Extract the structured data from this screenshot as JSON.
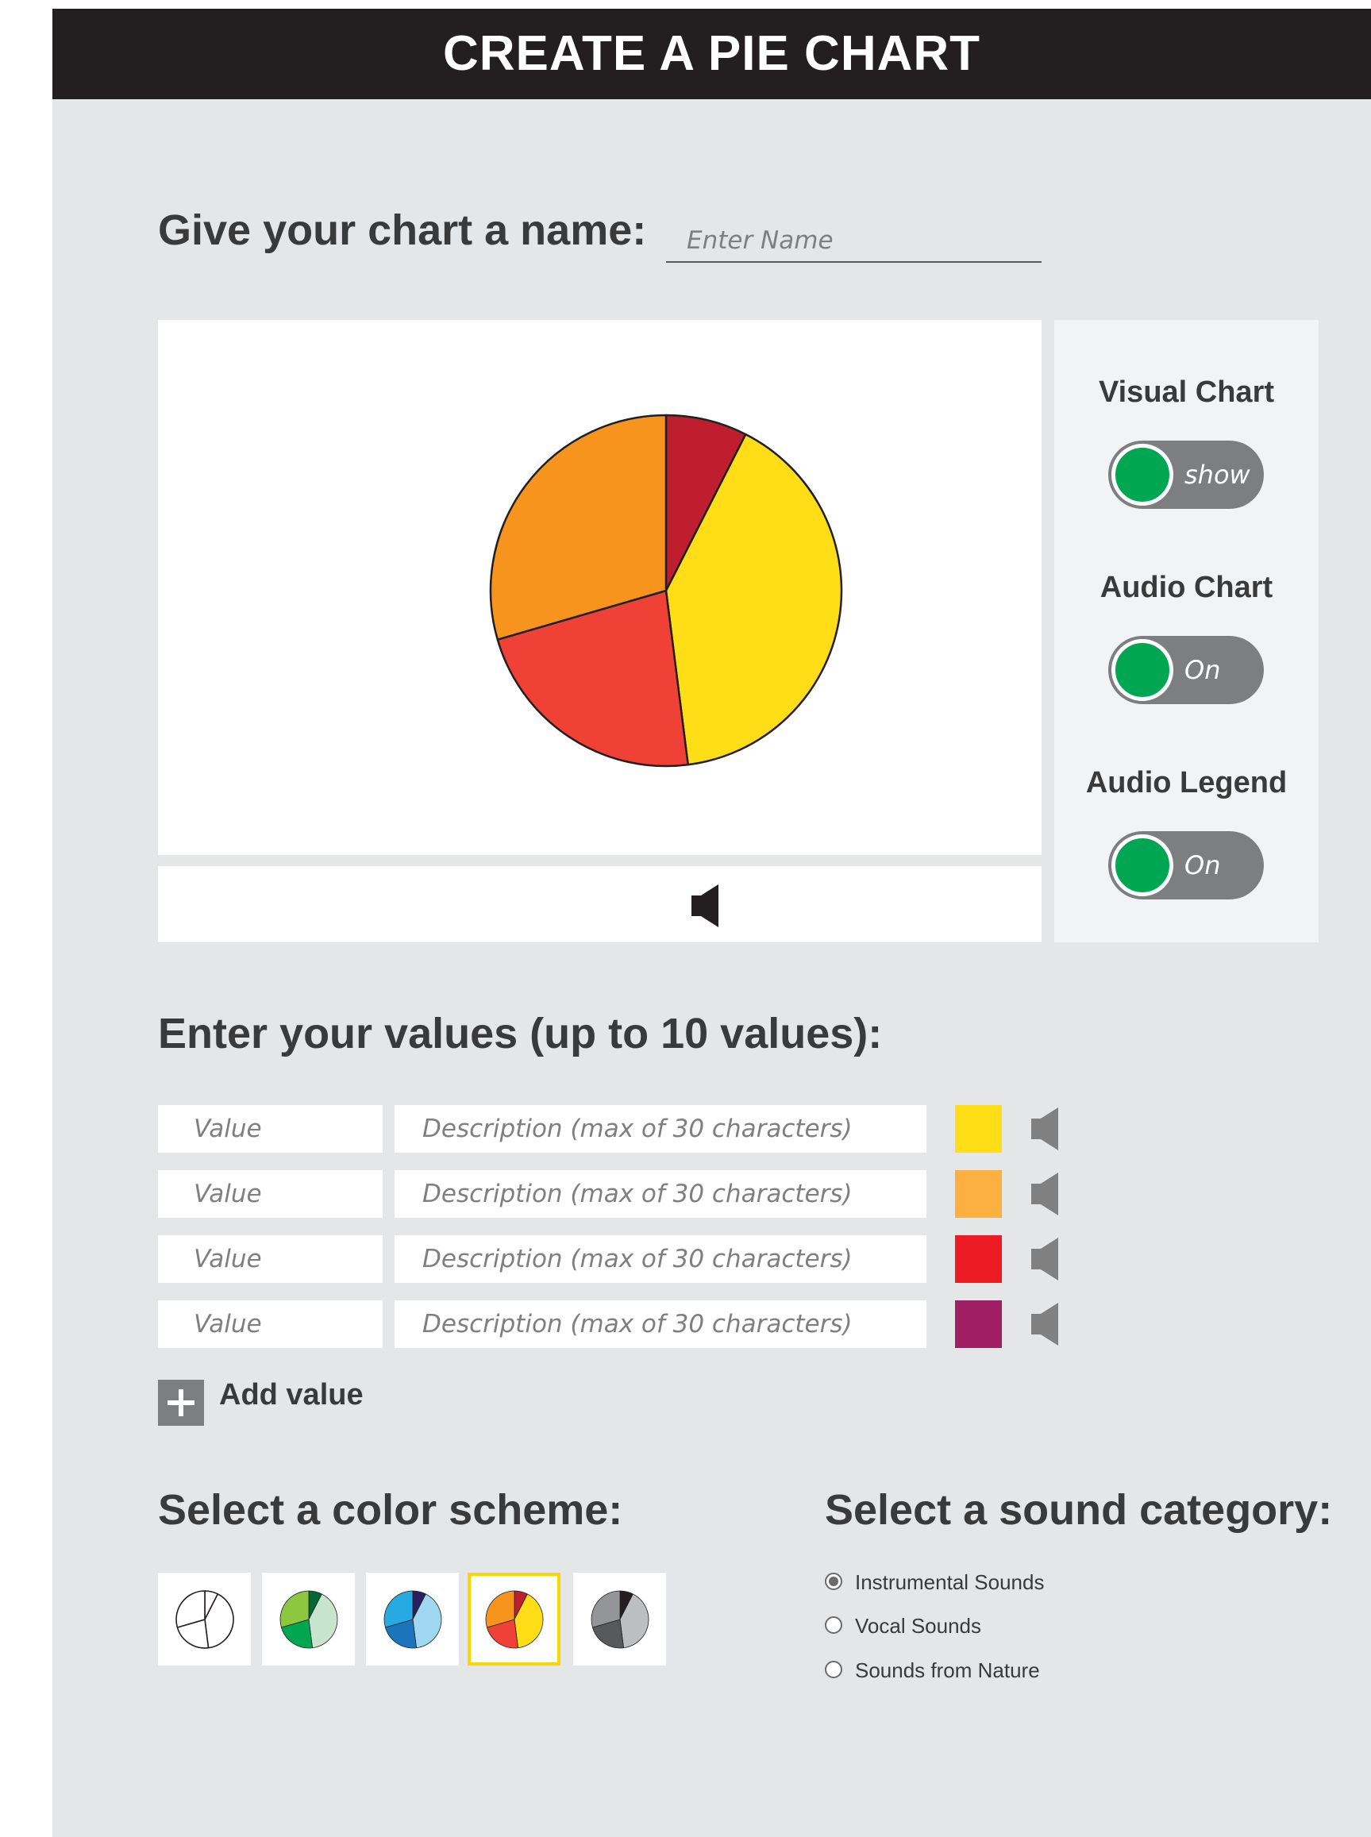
{
  "title": "CREATE A PIE CHART",
  "name_prompt": {
    "label": "Give your chart a name:",
    "placeholder": "Enter Name"
  },
  "chart_data": {
    "type": "pie",
    "values": [
      7.5,
      40.5,
      22.5,
      29.5
    ],
    "colors": [
      "#be1e2d",
      "#ffde17",
      "#ef4136",
      "#f7941d"
    ]
  },
  "toggles": [
    {
      "label": "Visual Chart",
      "state": "show"
    },
    {
      "label": "Audio Chart",
      "state": "On"
    },
    {
      "label": "Audio Legend",
      "state": "On"
    }
  ],
  "values_section": {
    "title": "Enter your values (up to 10 values):",
    "rows": [
      {
        "value_placeholder": "Value",
        "description_placeholder": "Description (max of 30 characters)",
        "color": "#ffde17"
      },
      {
        "value_placeholder": "Value",
        "description_placeholder": "Description (max of 30 characters)",
        "color": "#fbb040"
      },
      {
        "value_placeholder": "Value",
        "description_placeholder": "Description (max of 30 characters)",
        "color": "#ed1c24"
      },
      {
        "value_placeholder": "Value",
        "description_placeholder": "Description (max of 30 characters)",
        "color": "#9e1f63"
      }
    ],
    "add_label": "Add value"
  },
  "color_scheme": {
    "title": "Select a color scheme:",
    "selected_index": 3,
    "schemes": [
      {
        "name": "outline",
        "colors": [
          "#ffffff",
          "#ffffff",
          "#ffffff",
          "#ffffff"
        ]
      },
      {
        "name": "green",
        "colors": [
          "#006838",
          "#c7e5cd",
          "#00a651",
          "#8dc63f"
        ]
      },
      {
        "name": "blue",
        "colors": [
          "#262262",
          "#9ed7ef",
          "#1c75bc",
          "#27aae1"
        ]
      },
      {
        "name": "warm",
        "colors": [
          "#be1e2d",
          "#ffde17",
          "#ef4136",
          "#f7941d"
        ]
      },
      {
        "name": "gray",
        "colors": [
          "#231f20",
          "#bcbec0",
          "#58595b",
          "#939598"
        ]
      }
    ]
  },
  "sound_category": {
    "title": "Select a sound category:",
    "selected_index": 0,
    "options": [
      "Instrumental Sounds",
      "Vocal Sounds",
      "Sounds from Nature"
    ]
  }
}
